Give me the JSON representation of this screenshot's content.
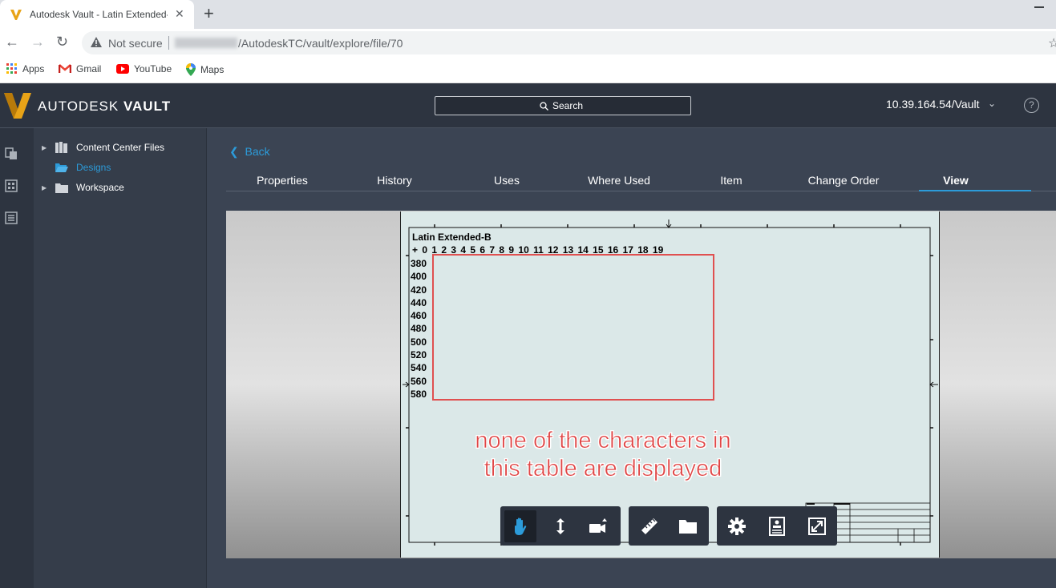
{
  "browser": {
    "tab_title": "Autodesk Vault - Latin Extended-",
    "tab_close": "✕",
    "new_tab": "+",
    "security_label": "Not secure",
    "url_path": "/AutodeskTC/vault/explore/file/70",
    "bookmarks": [
      {
        "label": "Apps",
        "icon": "apps-grid-icon"
      },
      {
        "label": "Gmail",
        "icon": "gmail-icon"
      },
      {
        "label": "YouTube",
        "icon": "youtube-icon"
      },
      {
        "label": "Maps",
        "icon": "maps-icon"
      }
    ]
  },
  "header": {
    "brand_light": "AUTODESK",
    "brand_bold": "VAULT",
    "search_label": "Search",
    "server": "10.39.164.54/Vault",
    "help": "?"
  },
  "tree": {
    "items": [
      {
        "label": "Content Center Files",
        "icon": "library-icon"
      },
      {
        "label": "Designs",
        "icon": "folder-open-icon"
      },
      {
        "label": "Workspace",
        "icon": "folder-icon"
      }
    ]
  },
  "main": {
    "back_label": "Back",
    "tabs": [
      "Properties",
      "History",
      "Uses",
      "Where Used",
      "Item",
      "Change Order",
      "View"
    ],
    "active_tab": "View"
  },
  "drawing": {
    "title": "Latin Extended-B",
    "column_header": "+   0 1 2 3 4 5 6 7 8 9 10 11 12 13 14 15 16 17 18 19",
    "rows": [
      "380",
      "400",
      "420",
      "440",
      "460",
      "480",
      "500",
      "520",
      "540",
      "560",
      "580"
    ]
  },
  "annotation": {
    "line1": "none of the characters in",
    "line2": "this table are displayed",
    "color": "#e04646"
  },
  "colors": {
    "accent": "#2c9bd9",
    "header_bg": "#2d3440",
    "logo_gold": "#e8a317"
  }
}
